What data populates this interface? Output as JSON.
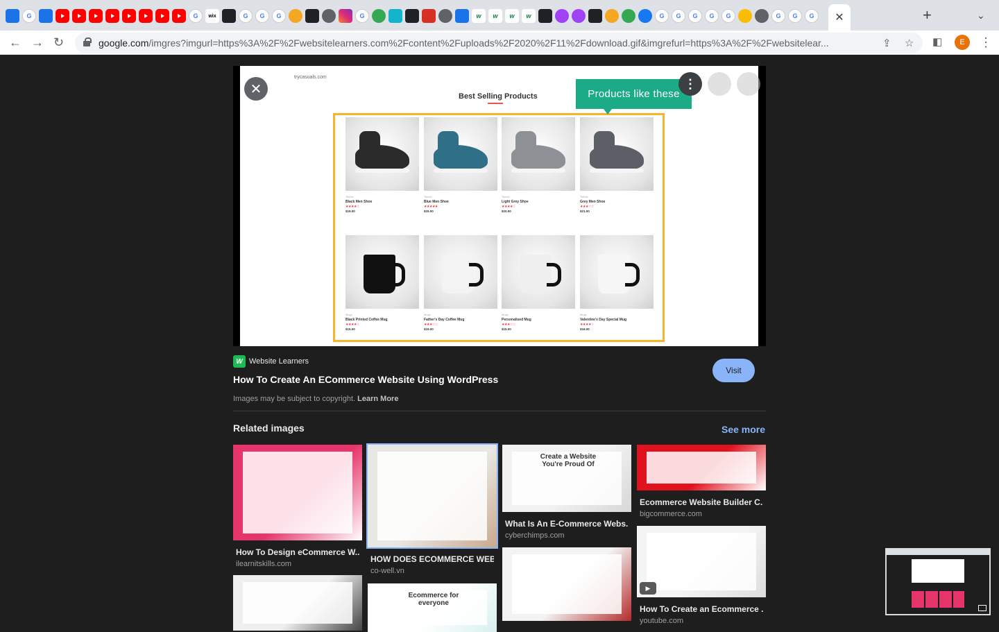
{
  "browser": {
    "url_main": "google.com",
    "url_rest": "/imgres?imgurl=https%3A%2F%2Fwebsitelearners.com%2Fcontent%2Fuploads%2F2020%2F11%2Fdownload.gif&imgrefurl=https%3A%2F%2Fwebsitelear...",
    "active_tab_close": "✕",
    "new_tab": "+",
    "profile_initial": "E",
    "tab_icons": [
      "share",
      "g",
      "share",
      "yt",
      "yt",
      "yt",
      "yt",
      "yt",
      "yt",
      "yt",
      "yt",
      "g",
      "wix",
      "dark",
      "g",
      "g",
      "g",
      "orange",
      "dark",
      "grey",
      "ig",
      "g",
      "green",
      "teal",
      "dark",
      "red",
      "grey",
      "blue",
      "w",
      "w",
      "w",
      "w",
      "dark",
      "purple",
      "purple",
      "dark",
      "orange",
      "green",
      "fb",
      "g",
      "g",
      "g",
      "g",
      "g",
      "yellow",
      "grey",
      "g",
      "g",
      "g"
    ]
  },
  "preview": {
    "site_url": "trycasuals.com",
    "site_heading": "Best Selling Products",
    "callout": "Products like these",
    "products": [
      {
        "cat": "Tshirts",
        "name": "Black Men Shoe",
        "stars": "★★★★☆",
        "price": "$19.00",
        "kind": "shoe",
        "color": "#2b2b2b"
      },
      {
        "cat": "Tshirts",
        "name": "Blue Men Shoe",
        "stars": "★★★★★",
        "price": "$25.00",
        "kind": "shoe",
        "color": "#2f6f87"
      },
      {
        "cat": "Tshirts",
        "name": "Light Grey Shoe",
        "stars": "★★★★☆",
        "price": "$20.00",
        "kind": "shoe",
        "color": "#8d9196"
      },
      {
        "cat": "Tshirts",
        "name": "Grey Men Shoe",
        "stars": "★★★☆☆",
        "price": "$21.00",
        "kind": "shoe",
        "color": "#5c6066"
      },
      {
        "cat": "Mugs",
        "name": "Black Printed Coffee Mug",
        "stars": "★★★★☆",
        "price": "$15.00",
        "kind": "mug",
        "color": "#111111"
      },
      {
        "cat": "Mugs",
        "name": "Father's Day Coffee Mug",
        "stars": "★★★☆☆",
        "price": "$19.00",
        "kind": "mug",
        "color": "#f3f3f3"
      },
      {
        "cat": "Mugs",
        "name": "Personalised Mug",
        "stars": "★★★☆☆",
        "price": "$15.00",
        "kind": "mug",
        "color": "#efefef"
      },
      {
        "cat": "Mugs",
        "name": "Valentine's Day Special Mug",
        "stars": "★★★★☆",
        "price": "$18.00",
        "kind": "mug",
        "color": "#f6f6f6"
      }
    ],
    "close_icon": "✕",
    "more_icon": "⋮"
  },
  "info": {
    "source_name": "Website Learners",
    "title": "How To Create An ECommerce Website Using WordPress",
    "visit_label": "Visit",
    "copyright": "Images may be subject to copyright.",
    "learn_more": "Learn More"
  },
  "related": {
    "heading": "Related images",
    "see_more": "See more",
    "items": [
      {
        "caption": "How To Design eCommerce W...",
        "domain": "ilearnitskills.com",
        "c1": "#e6356a",
        "c2": "#ffffff"
      },
      {
        "caption": "HOW DOES ECOMMERCE WEB...",
        "domain": "co-well.vn",
        "c1": "#e9e7e4",
        "c2": "#c9a98c"
      },
      {
        "caption": "What Is An E-Commerce Webs...",
        "domain": "cyberchimps.com",
        "c1": "#f2f2f2",
        "c2": "#d7d7d7",
        "heading": "Create a Website You're Proud Of"
      },
      {
        "caption": "Ecommerce Website Builder C...",
        "domain": "bigcommerce.com",
        "c1": "#e0121e",
        "c2": "#ffffff"
      },
      {
        "caption": "How To Create an Ecommerce ...",
        "domain": "youtube.com",
        "c1": "#f4f4f4",
        "c2": "#dddddd",
        "play": "▶"
      },
      {
        "caption": "",
        "domain": "",
        "c1": "#f3f3f3",
        "c2": "#b52b2b"
      },
      {
        "caption": "",
        "domain": "",
        "c1": "#efefef",
        "c2": "#444444"
      },
      {
        "caption": "",
        "domain": "",
        "c1": "#ffffff",
        "c2": "#d7f0ee",
        "heading": "Ecommerce for everyone"
      }
    ]
  }
}
